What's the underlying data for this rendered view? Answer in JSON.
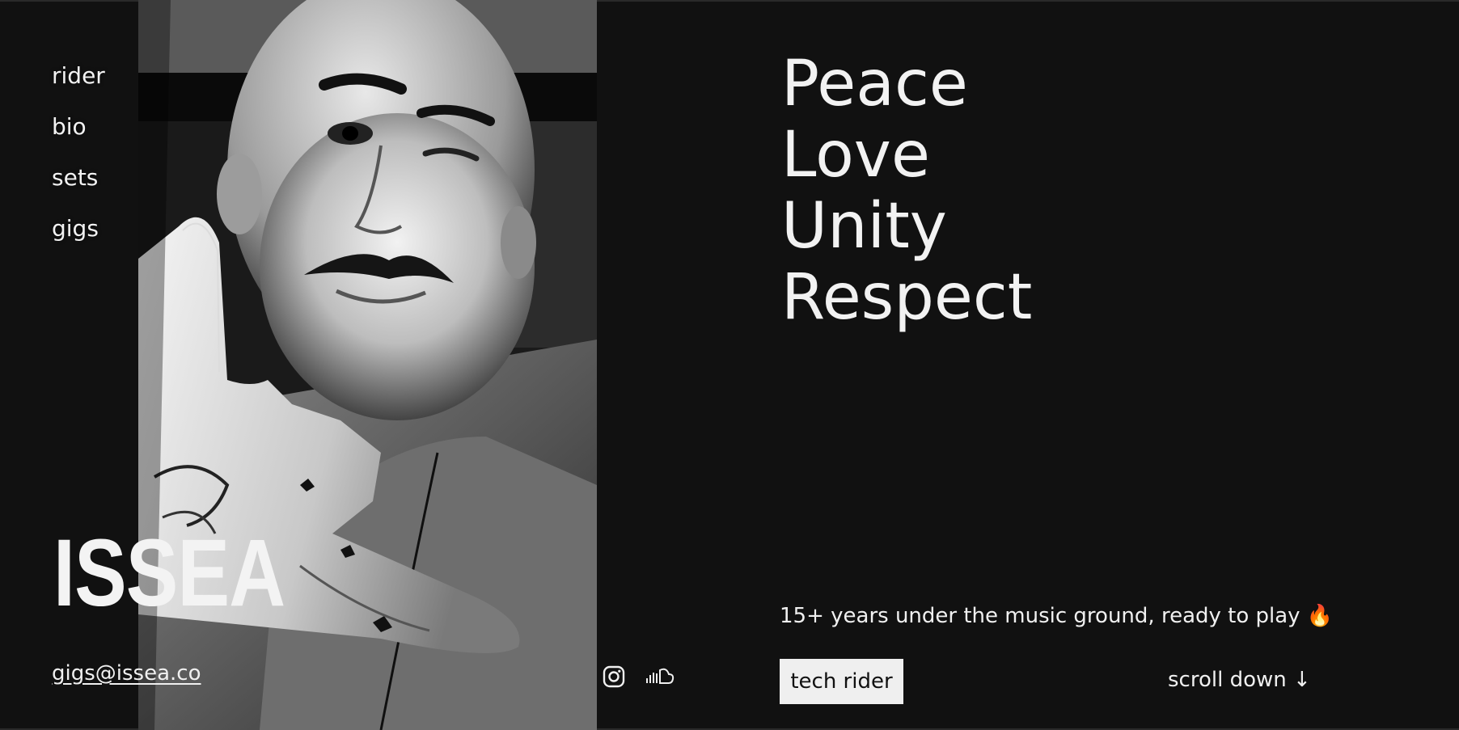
{
  "nav": {
    "items": [
      {
        "label": "rider"
      },
      {
        "label": "bio"
      },
      {
        "label": "sets"
      },
      {
        "label": "gigs"
      }
    ]
  },
  "brand": {
    "name": "ISSEA"
  },
  "contact": {
    "email": "gigs@issea.co"
  },
  "social": {
    "icons": [
      "instagram-icon",
      "soundcloud-icon"
    ]
  },
  "hero": {
    "lines": [
      "Peace",
      "Love",
      "Unity",
      "Respect"
    ],
    "tagline": "15+ years under the music ground, ready to play",
    "tagline_emoji": "🔥",
    "cta_label": "tech rider",
    "scroll_label": "scroll down ↓"
  },
  "colors": {
    "background": "#111111",
    "text": "#f0f0f0",
    "button_bg": "#efefef"
  }
}
